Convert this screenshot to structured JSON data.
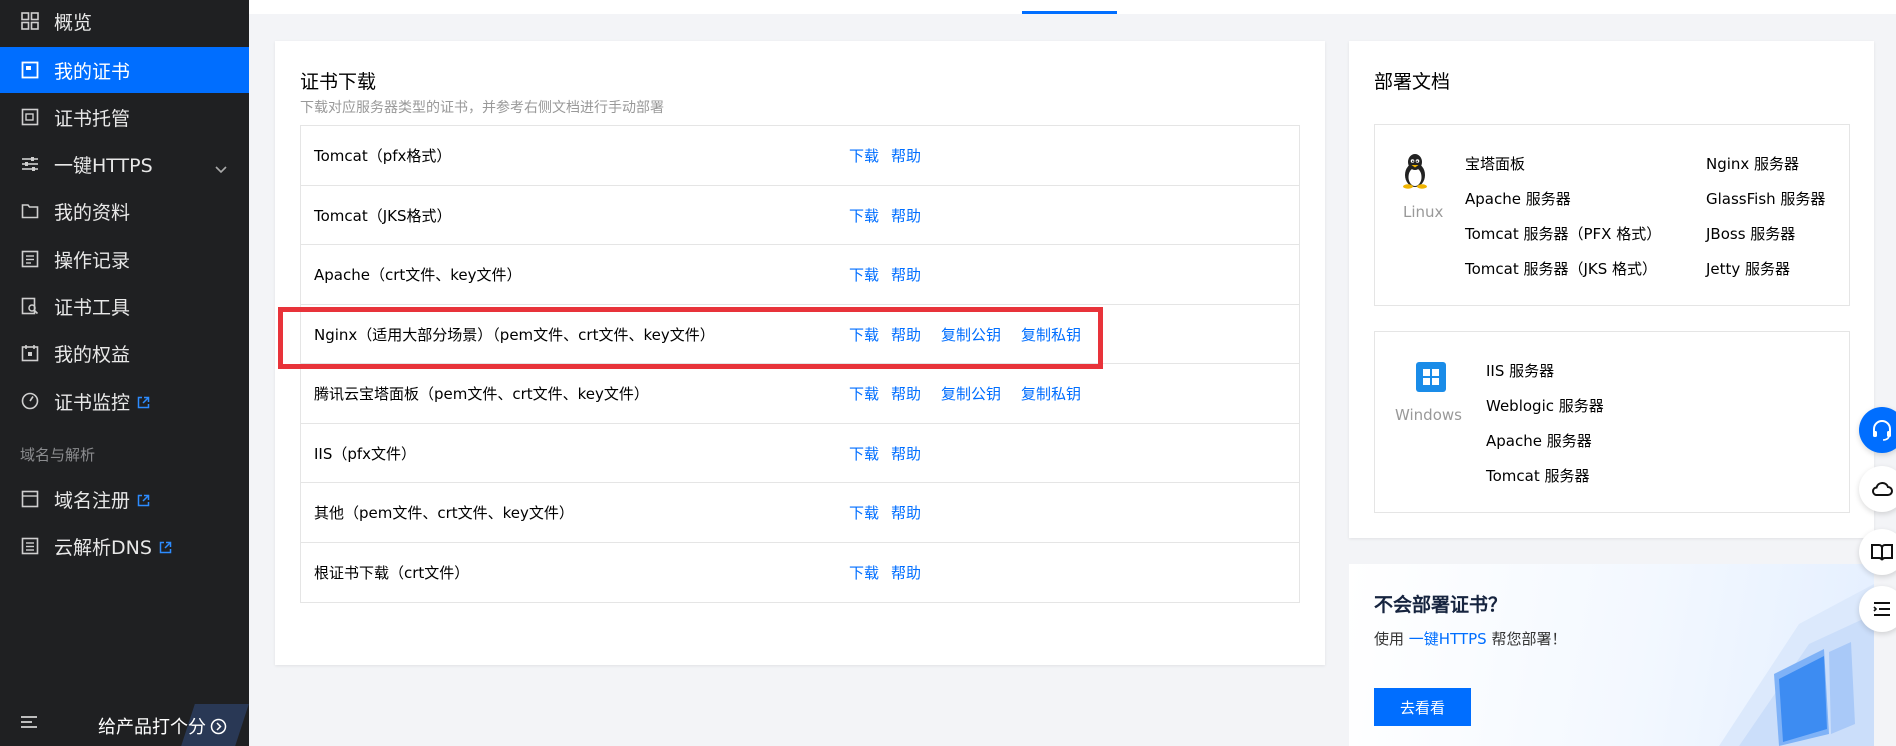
{
  "sidebar": {
    "items": [
      {
        "label": "概览",
        "icon": "dashboard-icon"
      },
      {
        "label": "我的证书",
        "icon": "certificate-icon",
        "active": true
      },
      {
        "label": "证书托管",
        "icon": "hosting-icon"
      },
      {
        "label": "一键HTTPS",
        "icon": "sliders-icon",
        "expandable": true
      },
      {
        "label": "我的资料",
        "icon": "folder-icon"
      },
      {
        "label": "操作记录",
        "icon": "record-icon"
      },
      {
        "label": "证书工具",
        "icon": "tool-icon"
      },
      {
        "label": "我的权益",
        "icon": "calendar-icon"
      },
      {
        "label": "证书监控",
        "icon": "monitor-icon",
        "external": true
      }
    ],
    "group_label": "域名与解析",
    "group_items": [
      {
        "label": "域名注册",
        "icon": "domain-icon",
        "external": true
      },
      {
        "label": "云解析DNS",
        "icon": "dns-icon",
        "external": true
      }
    ],
    "rate_label": "给产品打个分"
  },
  "download": {
    "title": "证书下载",
    "subtitle": "下载对应服务器类型的证书，并参考右侧文档进行手动部署",
    "rows": [
      {
        "name": "Tomcat（pfx格式）",
        "actions": [
          "下载",
          "帮助"
        ]
      },
      {
        "name": "Tomcat（JKS格式）",
        "actions": [
          "下载",
          "帮助"
        ]
      },
      {
        "name": "Apache（crt文件、key文件）",
        "actions": [
          "下载",
          "帮助"
        ]
      },
      {
        "name": "Nginx（适用大部分场景）（pem文件、crt文件、key文件）",
        "actions": [
          "下载",
          "帮助",
          "复制公钥",
          "复制私钥"
        ]
      },
      {
        "name": "腾讯云宝塔面板（pem文件、crt文件、key文件）",
        "actions": [
          "下载",
          "帮助",
          "复制公钥",
          "复制私钥"
        ]
      },
      {
        "name": "IIS（pfx文件）",
        "actions": [
          "下载",
          "帮助"
        ]
      },
      {
        "name": "其他（pem文件、crt文件、key文件）",
        "actions": [
          "下载",
          "帮助"
        ]
      },
      {
        "name": "根证书下载（crt文件）",
        "actions": [
          "下载",
          "帮助"
        ]
      }
    ]
  },
  "docs": {
    "title": "部署文档",
    "linux": {
      "label": "Linux",
      "col1": [
        "宝塔面板",
        "Apache 服务器",
        "Tomcat 服务器（PFX 格式）",
        "Tomcat 服务器（JKS 格式）"
      ],
      "col2": [
        "Nginx 服务器",
        "GlassFish 服务器",
        "JBoss 服务器",
        "Jetty 服务器"
      ]
    },
    "windows": {
      "label": "Windows",
      "items": [
        "IIS 服务器",
        "Weblogic 服务器",
        "Apache 服务器",
        "Tomcat 服务器"
      ]
    }
  },
  "promo": {
    "title": "不会部署证书？",
    "desc_prefix": "使用",
    "desc_link": "一键HTTPS",
    "desc_suffix": "帮您部署！",
    "button": "去看看"
  },
  "colors": {
    "accent": "#006eff",
    "sidebar_bg": "#1f2022",
    "highlight": "#e8333a"
  }
}
